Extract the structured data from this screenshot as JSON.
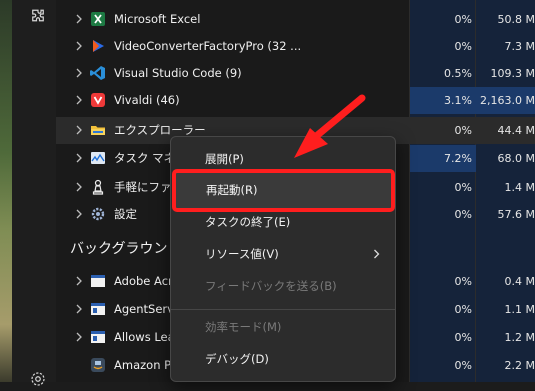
{
  "rows": [
    {
      "name": "Microsoft Excel",
      "cpu": "0%",
      "mem": "50.8 M",
      "icon": "excel-icon"
    },
    {
      "name": "VideoConverterFactoryPro (32 ...",
      "cpu": "0%",
      "mem": "7.3 M",
      "icon": "video-converter-icon"
    },
    {
      "name": "Visual Studio Code (9)",
      "cpu": "0.5%",
      "mem": "109.3 M",
      "icon": "vscode-icon"
    },
    {
      "name": "Vivaldi (46)",
      "cpu": "3.1%",
      "mem": "2,163.0 M",
      "icon": "vivaldi-icon"
    },
    {
      "name": "エクスプローラー",
      "cpu": "0%",
      "mem": "44.4 M",
      "icon": "explorer-folder-icon"
    },
    {
      "name": "タスク マネー",
      "cpu": "7.2%",
      "mem": "68.0 M",
      "icon": "task-manager-icon"
    },
    {
      "name": "手軽にファイ",
      "cpu": "0%",
      "mem": "1.4 M",
      "icon": "chess-pawn-icon"
    },
    {
      "name": "設定",
      "cpu": "0%",
      "mem": "57.6 M",
      "icon": "settings-gear-icon"
    }
  ],
  "section": "バックグラウンド",
  "bg_rows": [
    {
      "name": "Adobe Acr",
      "cpu": "0%",
      "mem": "0.4 M",
      "icon": "window-app-icon"
    },
    {
      "name": "AgentServ",
      "cpu": "0%",
      "mem": "1.1 M",
      "icon": "window-app-icon"
    },
    {
      "name": "Allows Lea",
      "cpu": "0%",
      "mem": "1.2 M",
      "icon": "window-app-icon"
    },
    {
      "name": "Amazon P",
      "cpu": "0%",
      "mem": "2.2 M",
      "icon": "amazon-photos-icon"
    }
  ],
  "menu": {
    "items": [
      {
        "label": "展開(P)",
        "enabled": true
      },
      {
        "label": "再起動(R)",
        "enabled": true
      },
      {
        "label": "タスクの終了(E)",
        "enabled": true
      },
      {
        "label": "リソース値(V)",
        "enabled": true,
        "submenu": true
      },
      {
        "label": "フィードバックを送る(B)",
        "enabled": false
      },
      {
        "label": "効率モード(M)",
        "enabled": false
      },
      {
        "label": "デバッグ(D)",
        "enabled": true
      }
    ]
  },
  "colors": {
    "highlight": "#ff1e1e",
    "arrow": "#ff1e1e",
    "cpu_hot": "#1b3a6a"
  }
}
